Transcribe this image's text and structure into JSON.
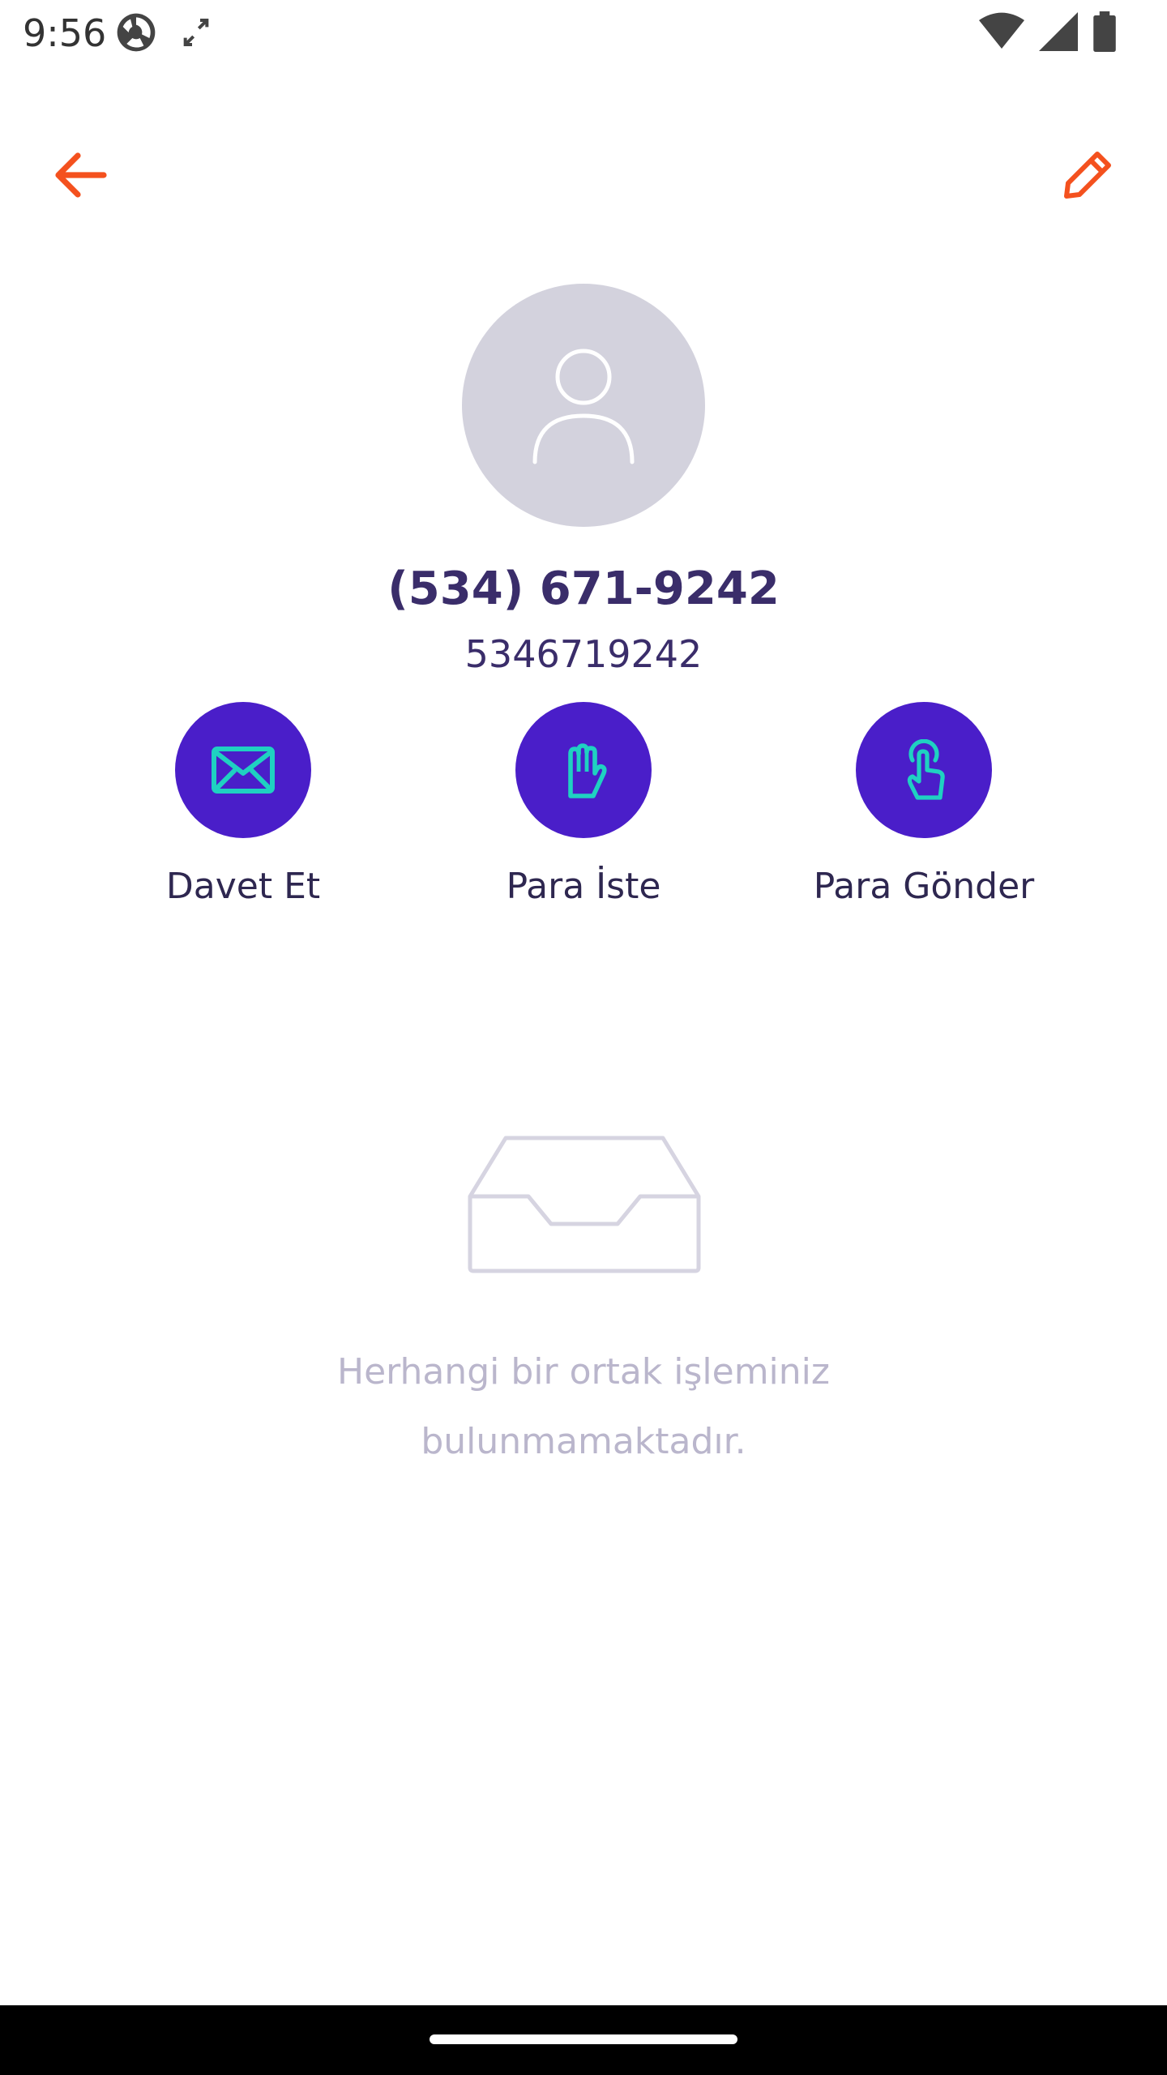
{
  "status_bar": {
    "time": "9:56",
    "icons": [
      "data-saver-icon",
      "screen-rotate-icon",
      "wifi-icon",
      "cellular-signal-icon",
      "battery-icon"
    ]
  },
  "toolbar": {
    "back_icon": "arrow-left-icon",
    "edit_icon": "pencil-icon"
  },
  "contact": {
    "avatar_icon": "person-placeholder-icon",
    "display_name": "(534) 671-9242",
    "phone_number": "5346719242"
  },
  "actions": [
    {
      "label": "Davet Et",
      "icon": "envelope-icon"
    },
    {
      "label": "Para İste",
      "icon": "hand-icon"
    },
    {
      "label": "Para Gönder",
      "icon": "tap-finger-icon"
    }
  ],
  "empty_state": {
    "icon": "empty-inbox-icon",
    "line1": "Herhangi bir ortak işleminiz",
    "line2": "bulunmamaktadır."
  },
  "colors": {
    "accent": "#f4511e",
    "primary": "#4a1ec9",
    "icon_teal": "#1fd1c1",
    "text_dark": "#3a2d6a",
    "text_muted": "#bab6cc",
    "avatar_bg": "#d3d2dd"
  }
}
